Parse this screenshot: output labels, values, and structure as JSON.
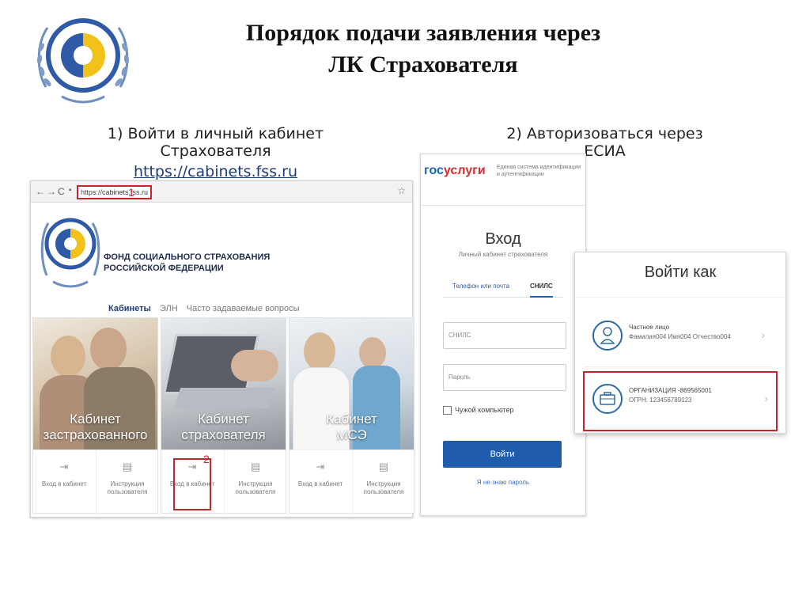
{
  "slide": {
    "title_line1": "Порядок подачи заявления через",
    "title_line2": "ЛК Страхователя",
    "step1_text": "1) Войти в личный кабинет Страхователя",
    "step1_link": "https://cabinets.fss.ru",
    "step2_text": "2) Авторизоваться через ЕСИА"
  },
  "browser": {
    "url": "https://cabinets.fss.ru",
    "marker1": "1",
    "marker2": "2",
    "org_name_line1": "ФОНД СОЦИАЛЬНОГО СТРАХОВАНИЯ",
    "org_name_line2": "РОССИЙСКОЙ ФЕДЕРАЦИИ",
    "tabs": [
      "Кабинеты",
      "ЭЛН",
      "Часто задаваемые вопросы"
    ],
    "cards": [
      {
        "title_line1": "Кабинет",
        "title_line2": "застрахованного",
        "login": "Вход в кабинет",
        "manual": "Инструкция пользователя"
      },
      {
        "title_line1": "Кабинет",
        "title_line2": "страхователя",
        "login": "Вход в кабинет",
        "manual": "Инструкция пользователя"
      },
      {
        "title_line1": "Кабинет",
        "title_line2": "МСЭ",
        "login": "Вход в кабинет",
        "manual": "Инструкция пользователя"
      }
    ]
  },
  "gosuslugi": {
    "brand_part1": "гос",
    "brand_part2": "услуги",
    "desc": "Единая система идентификации и аутентификации",
    "login_title": "Вход",
    "login_subtitle": "Личный кабинет страхователя",
    "tab_phone": "Телефон или почта",
    "tab_snils": "СНИЛС",
    "snils_placeholder": "СНИЛС",
    "password_placeholder": "Пароль",
    "foreign_computer": "Чужой компьютер",
    "login_button": "Войти",
    "forgot_password": "Я не знаю пароль"
  },
  "login_as": {
    "title": "Войти как",
    "private_line1": "Частное лицо",
    "private_line2": "Фамилия004 Имя004 Отчество004",
    "org_line1": "ОРГАНИЗАЦИЯ -869565001",
    "org_line2": "ОГРН: 123456789123"
  },
  "colors": {
    "highlight_red": "#c0282b",
    "fss_blue": "#1f3c78",
    "gosu_button": "#1f5cab"
  }
}
